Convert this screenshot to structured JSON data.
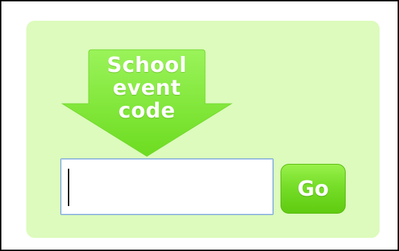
{
  "prompt": {
    "lines": [
      "School",
      "event",
      "code"
    ],
    "arrow_color_top": "#9af35a",
    "arrow_color_bottom": "#6ddc20"
  },
  "event_code_input": {
    "value": "",
    "placeholder": ""
  },
  "go_button": {
    "label": "Go",
    "color": "#6fd91f"
  },
  "panel": {
    "background": "#dcfbbc"
  }
}
